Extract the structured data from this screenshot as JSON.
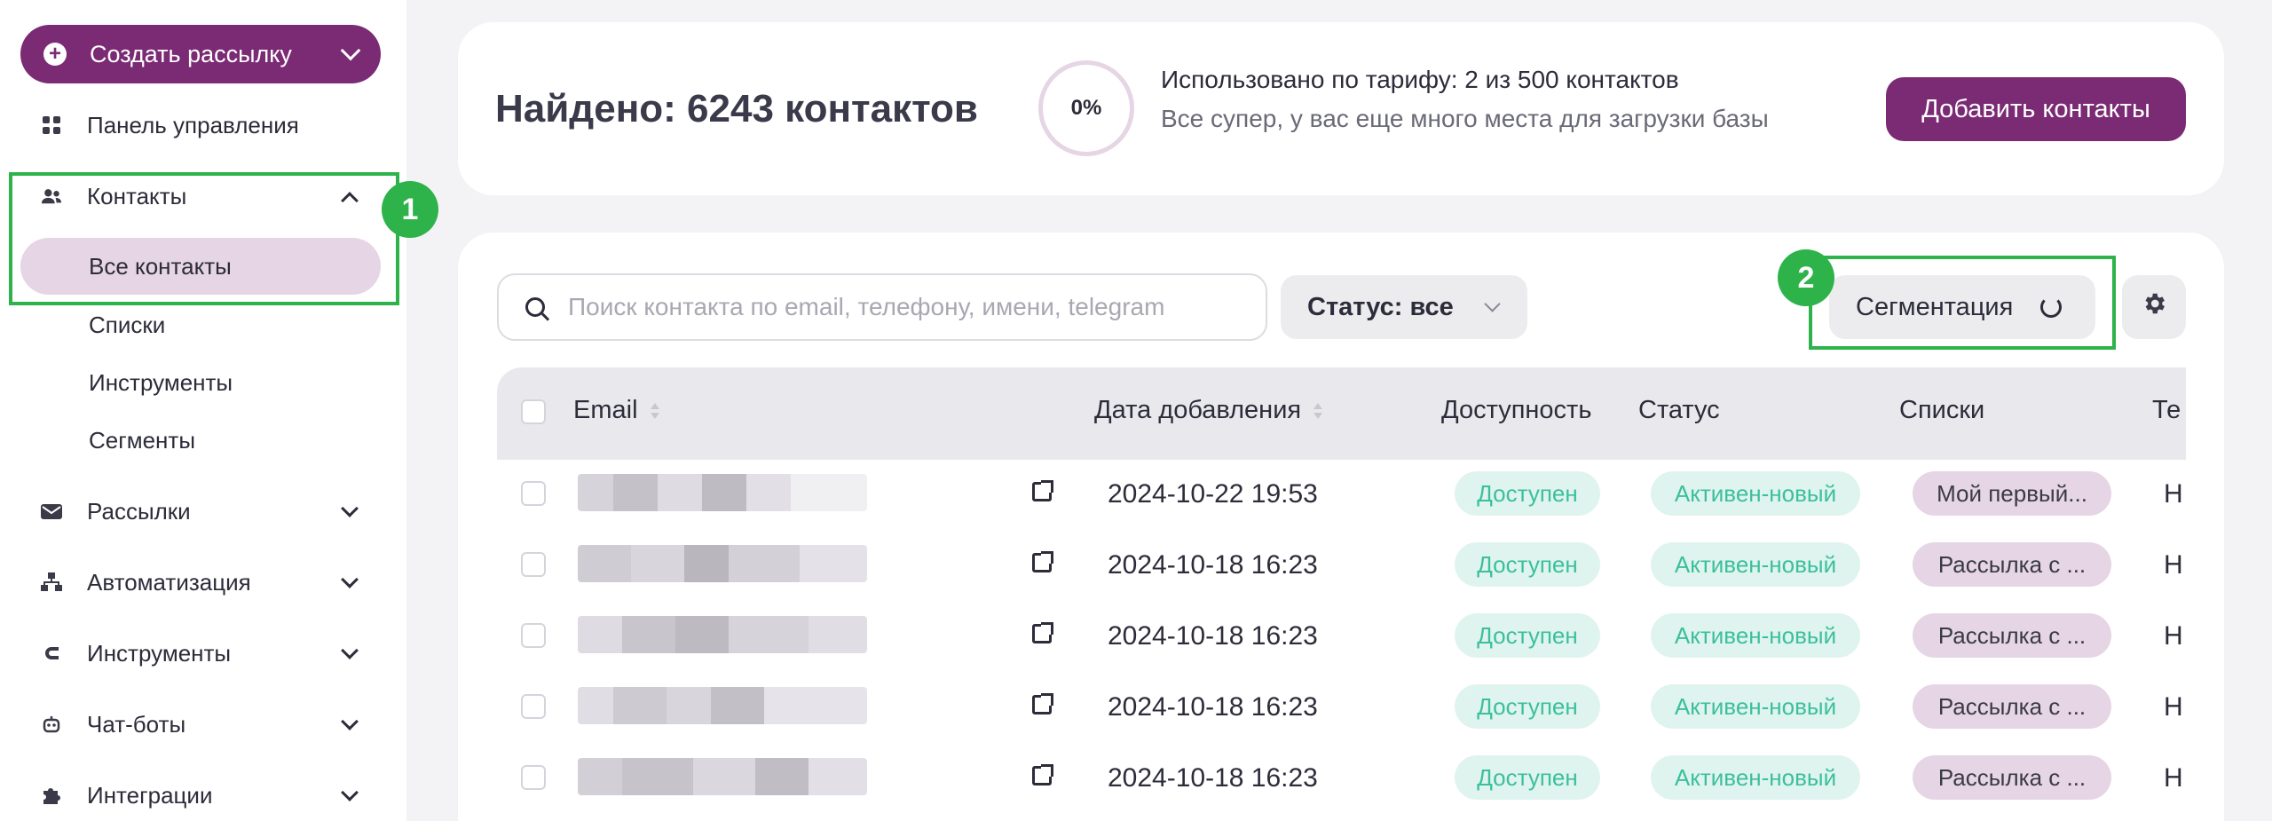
{
  "sidebar": {
    "create_label": "Создать рассылку",
    "items": [
      {
        "label": "Панель управления",
        "icon": "dashboard-icon"
      },
      {
        "label": "Контакты",
        "icon": "users-icon"
      },
      {
        "label": "Рассылки",
        "icon": "mail-icon"
      },
      {
        "label": "Автоматизация",
        "icon": "hierarchy-icon"
      },
      {
        "label": "Инструменты",
        "icon": "magnet-icon"
      },
      {
        "label": "Чат-боты",
        "icon": "bot-icon"
      },
      {
        "label": "Интеграции",
        "icon": "puzzle-icon"
      }
    ],
    "sub_items": [
      "Все контакты",
      "Списки",
      "Инструменты",
      "Сегменты"
    ]
  },
  "annotations": {
    "one": "1",
    "two": "2"
  },
  "summary": {
    "found": "Найдено: 6243 контактов",
    "usage_percent": "0%",
    "quota_line1": "Использовано по тарифу: 2 из 500 контактов",
    "quota_line2": "Все супер, у вас еще много места для загрузки базы",
    "add_button": "Добавить контакты"
  },
  "toolbar": {
    "search_placeholder": "Поиск контакта по email, телефону, имени, telegram",
    "status_label": "Статус: все",
    "segment_label": "Сегментация"
  },
  "table": {
    "headers": [
      "Email",
      "Дата добавления",
      "Доступность",
      "Статус",
      "Списки",
      "Те"
    ],
    "rows": [
      {
        "date": "2024-10-22 19:53",
        "availability": "Доступен",
        "status": "Активен-новый",
        "list": "Мой первый...",
        "cut": "Н"
      },
      {
        "date": "2024-10-18 16:23",
        "availability": "Доступен",
        "status": "Активен-новый",
        "list": "Рассылка с ...",
        "cut": "Н"
      },
      {
        "date": "2024-10-18 16:23",
        "availability": "Доступен",
        "status": "Активен-новый",
        "list": "Рассылка с ...",
        "cut": "Н"
      },
      {
        "date": "2024-10-18 16:23",
        "availability": "Доступен",
        "status": "Активен-новый",
        "list": "Рассылка с ...",
        "cut": "Н"
      },
      {
        "date": "2024-10-18 16:23",
        "availability": "Доступен",
        "status": "Активен-новый",
        "list": "Рассылка с ...",
        "cut": "Н"
      }
    ]
  },
  "colors": {
    "brand": "#7b2a74",
    "highlight": "#2db34a",
    "available": "#3cbf9d"
  }
}
